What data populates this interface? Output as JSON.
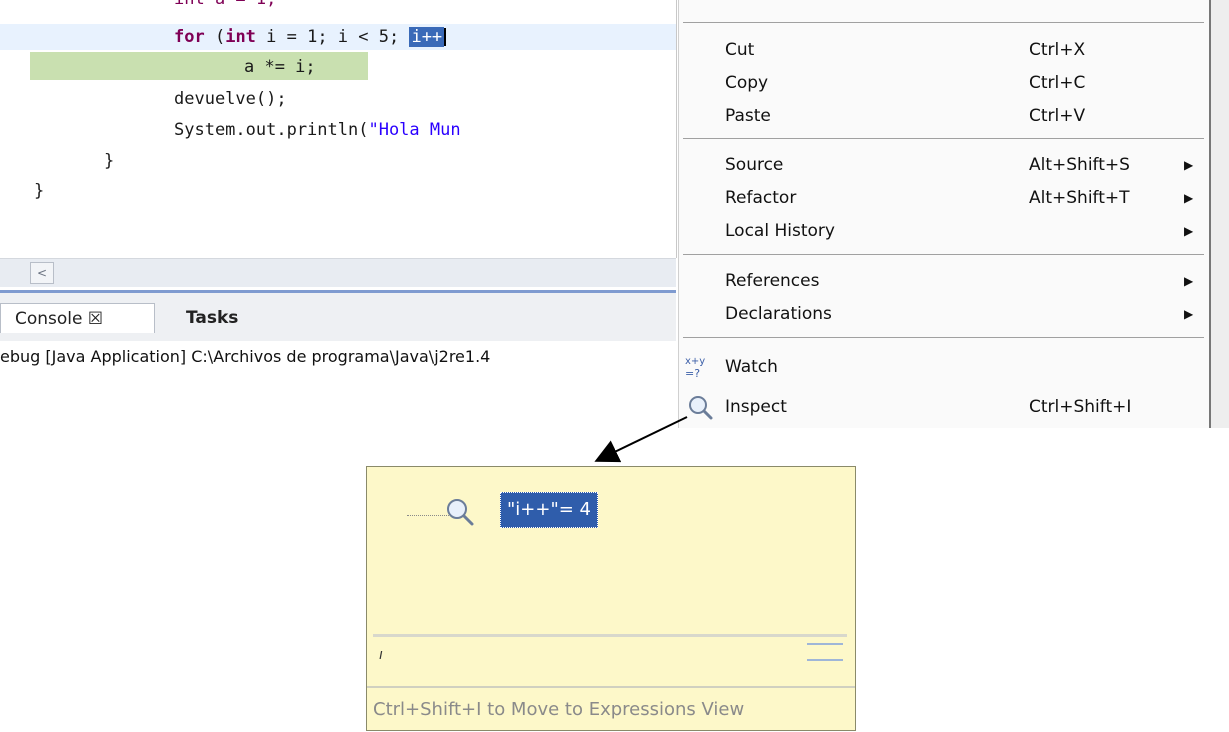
{
  "editor": {
    "lines": {
      "for_kw": "for",
      "for_open": " (",
      "int_kw": "int",
      "for_rest": " i = 1; i < 5; ",
      "for_sel": "i++",
      "assign": "a *= i;",
      "devuelve": "devuelve();",
      "println_pre": "System.out.println(",
      "println_str": "\"Hola Mun",
      "brace1": "}",
      "brace2": "}"
    },
    "scroll_left_glyph": "<"
  },
  "tabs": {
    "console": "Console ☒",
    "tasks": "Tasks"
  },
  "status_line": "ebug [Java Application] C:\\Archivos de programa\\Java\\j2re1.4",
  "menu": {
    "items": [
      {
        "label": "Cut",
        "shortcut": "Ctrl+X"
      },
      {
        "label": "Copy",
        "shortcut": "Ctrl+C"
      },
      {
        "label": "Paste",
        "shortcut": "Ctrl+V"
      },
      {
        "label": "Source",
        "shortcut": "Alt+Shift+S",
        "submenu": "▶"
      },
      {
        "label": "Refactor",
        "shortcut": "Alt+Shift+T",
        "submenu": "▶"
      },
      {
        "label": "Local History",
        "shortcut": "",
        "submenu": "▶"
      },
      {
        "label": "References",
        "shortcut": "",
        "submenu": "▶"
      },
      {
        "label": "Declarations",
        "shortcut": "",
        "submenu": "▶"
      },
      {
        "label": "Watch",
        "shortcut": "",
        "icon": "watch-expression-icon",
        "icon_text": "x+y"
      },
      {
        "label": "Inspect",
        "shortcut": "Ctrl+Shift+I",
        "icon": "magnifier-icon"
      }
    ]
  },
  "popup": {
    "expression": "\"i++\"= 4",
    "detail_caret": "ı",
    "hint": "Ctrl+Shift+I to Move to Expressions View"
  },
  "colors": {
    "keyword": "#7f0055",
    "string": "#2a00ff",
    "selection": "#3a6ab8",
    "current_line": "#c9e0b0",
    "popup_bg": "#fdf8c9"
  }
}
